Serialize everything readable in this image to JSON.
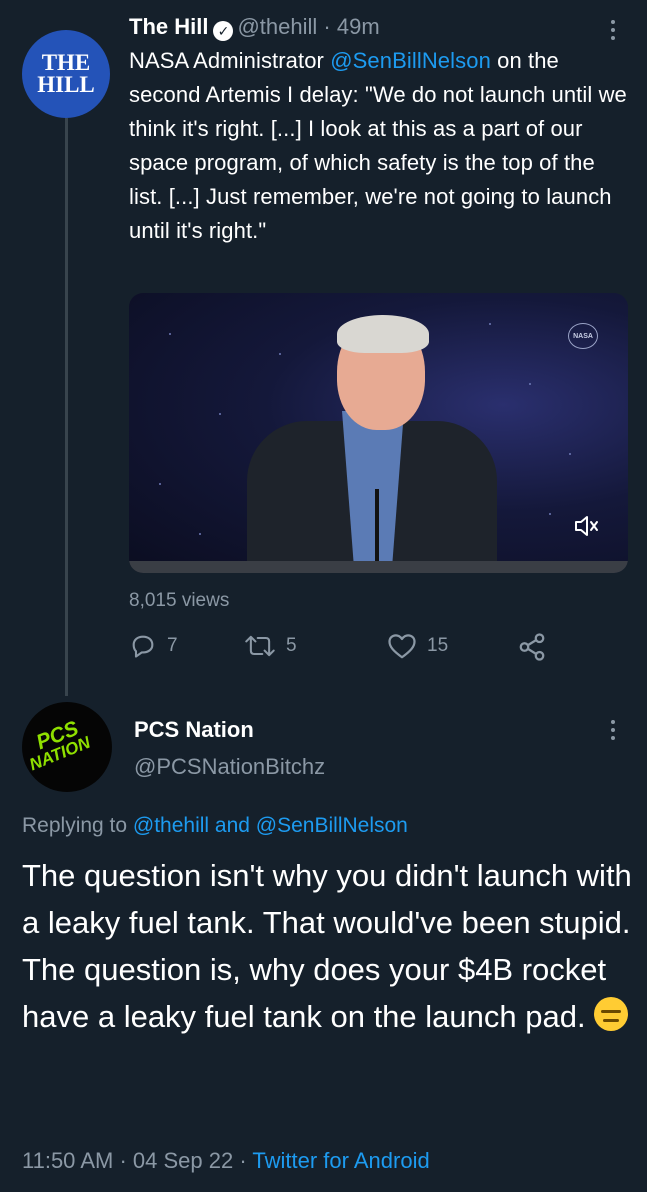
{
  "tweet1": {
    "avatar_text_line1": "THE",
    "avatar_text_line2": "HILL",
    "name": "The Hill",
    "handle": "@thehill",
    "separator": "·",
    "time": "49m",
    "text_before_mention": "NASA Administrator ",
    "mention": "@SenBillNelson",
    "text_after_mention": " on the second Artemis I delay: \"We do not launch until we think it's right. [...] I look at this as a part of our space program, of which safety is the top of the list. [...] Just remember, we're not going to launch until it's right.\"",
    "media": {
      "logo_text": "NASA",
      "mute_icon": "speaker-muted-icon"
    },
    "views": "8,015 views",
    "actions": {
      "reply_count": "7",
      "retweet_count": "5",
      "like_count": "15"
    }
  },
  "tweet2": {
    "avatar_line1": "PCS",
    "avatar_line2": "NATION",
    "name": "PCS Nation",
    "handle": "@PCSNationBitchz",
    "replying_prefix": "Replying to ",
    "replying_mentions": "@thehill and @SenBillNelson",
    "text_line1": "The question isn't why you didn't launch with a leaky fuel tank. That would've been stupid.",
    "text_line2": "The question is, why does your $4B rocket have a leaky fuel tank on the launch pad.",
    "time": "11:50 AM",
    "separator1": "·",
    "date": "04 Sep 22",
    "separator2": "·",
    "source": "Twitter for Android"
  },
  "colors": {
    "background": "#15202b",
    "accent": "#1d9bf0",
    "muted": "#8b98a5",
    "avatar_hill": "#2453b8"
  }
}
